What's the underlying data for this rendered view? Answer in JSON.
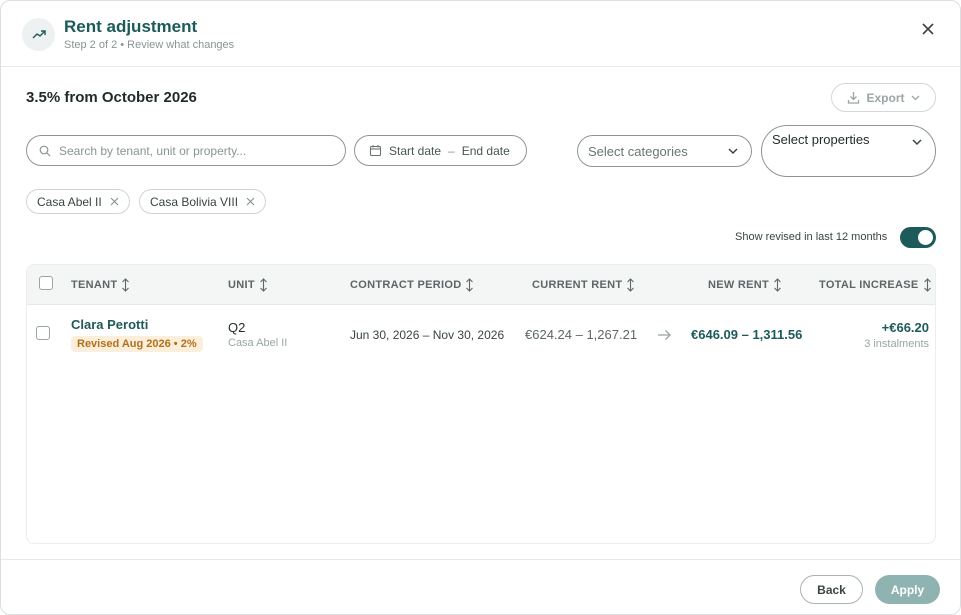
{
  "header": {
    "title": "Rent adjustment",
    "subtitle": "Step 2 of 2 • Review what changes"
  },
  "summary": {
    "title": "3.5% from October 2026",
    "export_label": "Export"
  },
  "filters": {
    "search_placeholder": "Search by tenant, unit or property...",
    "start_date": "Start date",
    "date_separator": "–",
    "end_date": "End date",
    "categories_placeholder": "Select categories",
    "properties_placeholder": "Select properties",
    "chips": [
      {
        "label": "Casa Abel II"
      },
      {
        "label": "Casa Bolivia VIII"
      }
    ],
    "toggle_label": "Show revised in last 12 months",
    "toggle_on": true
  },
  "table": {
    "columns": [
      "TENANT",
      "UNIT",
      "CONTRACT PERIOD",
      "CURRENT RENT",
      "NEW RENT",
      "TOTAL INCREASE"
    ],
    "rows": [
      {
        "tenant": "Clara Perotti",
        "badge": "Revised Aug 2026 • 2%",
        "unit": "Q2",
        "property": "Casa Abel II",
        "period": "Jun 30, 2026 – Nov 30, 2026",
        "current_rent": "€624.24 – 1,267.21",
        "new_rent": "€646.09 – 1,311.56",
        "total_increase": "+€66.20",
        "instalments": "3 instalments"
      }
    ]
  },
  "footer": {
    "back_label": "Back",
    "apply_label": "Apply"
  },
  "colors": {
    "primary": "#1d5a5a",
    "badge_bg": "#fbeedb",
    "badge_text": "#b3701a",
    "apply_disabled": "#8fb3b0"
  },
  "icons": {
    "header": "trending-up-icon",
    "close": "close-icon",
    "export": "download-icon",
    "search": "search-icon",
    "calendar": "calendar-icon",
    "sort": "sort-icon",
    "arrow": "arrow-right-icon"
  }
}
